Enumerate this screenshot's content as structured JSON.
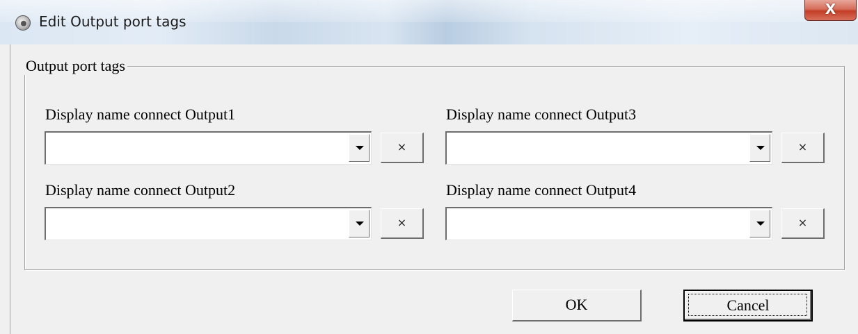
{
  "window": {
    "title": "Edit Output port tags",
    "close_glyph": "X",
    "icon": "app-gear-icon"
  },
  "group": {
    "label": "Output port tags"
  },
  "fields": [
    {
      "label": "Display name connect Output1",
      "value": "",
      "clear_glyph": "×"
    },
    {
      "label": "Display name connect Output2",
      "value": "",
      "clear_glyph": "×"
    },
    {
      "label": "Display name connect Output3",
      "value": "",
      "clear_glyph": "×"
    },
    {
      "label": "Display name connect Output4",
      "value": "",
      "clear_glyph": "×"
    }
  ],
  "buttons": {
    "ok": "OK",
    "cancel": "Cancel"
  }
}
